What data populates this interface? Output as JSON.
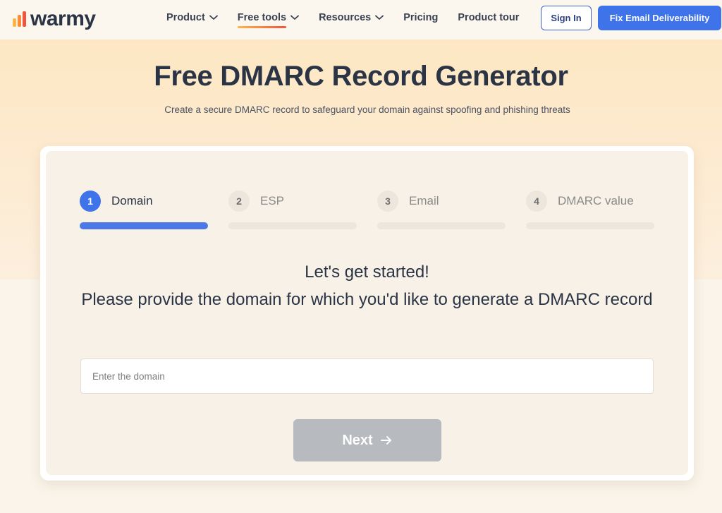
{
  "brand": {
    "name": "warmy"
  },
  "nav": {
    "items": [
      {
        "label": "Product",
        "has_dropdown": true,
        "active": false
      },
      {
        "label": "Free tools",
        "has_dropdown": true,
        "active": true
      },
      {
        "label": "Resources",
        "has_dropdown": true,
        "active": false
      },
      {
        "label": "Pricing",
        "has_dropdown": false,
        "active": false
      },
      {
        "label": "Product tour",
        "has_dropdown": false,
        "active": false
      }
    ],
    "signin_label": "Sign In",
    "cta_label": "Fix Email Deliverability"
  },
  "hero": {
    "title": "Free DMARC Record Generator",
    "subtitle": "Create a secure DMARC record to safeguard your domain against spoofing and phishing threats"
  },
  "wizard": {
    "steps": [
      {
        "number": "1",
        "label": "Domain",
        "active": true
      },
      {
        "number": "2",
        "label": "ESP",
        "active": false
      },
      {
        "number": "3",
        "label": "Email",
        "active": false
      },
      {
        "number": "4",
        "label": "DMARC value",
        "active": false
      }
    ],
    "prompt_line1": "Let's get started!",
    "prompt_line2": "Please provide the domain for which you'd like to generate a DMARC record",
    "domain_input": {
      "value": "",
      "placeholder": "Enter the domain"
    },
    "next_label": "Next"
  },
  "colors": {
    "accent": "#3e73ea",
    "text_dark": "#2b3445",
    "disabled_button": "#b7babe",
    "hero_gradient_top": "#fde7c3"
  },
  "icons": {
    "dropdown": "chevron-down-icon",
    "next": "arrow-right-icon",
    "logo": "warmy-bars-logo-icon"
  }
}
